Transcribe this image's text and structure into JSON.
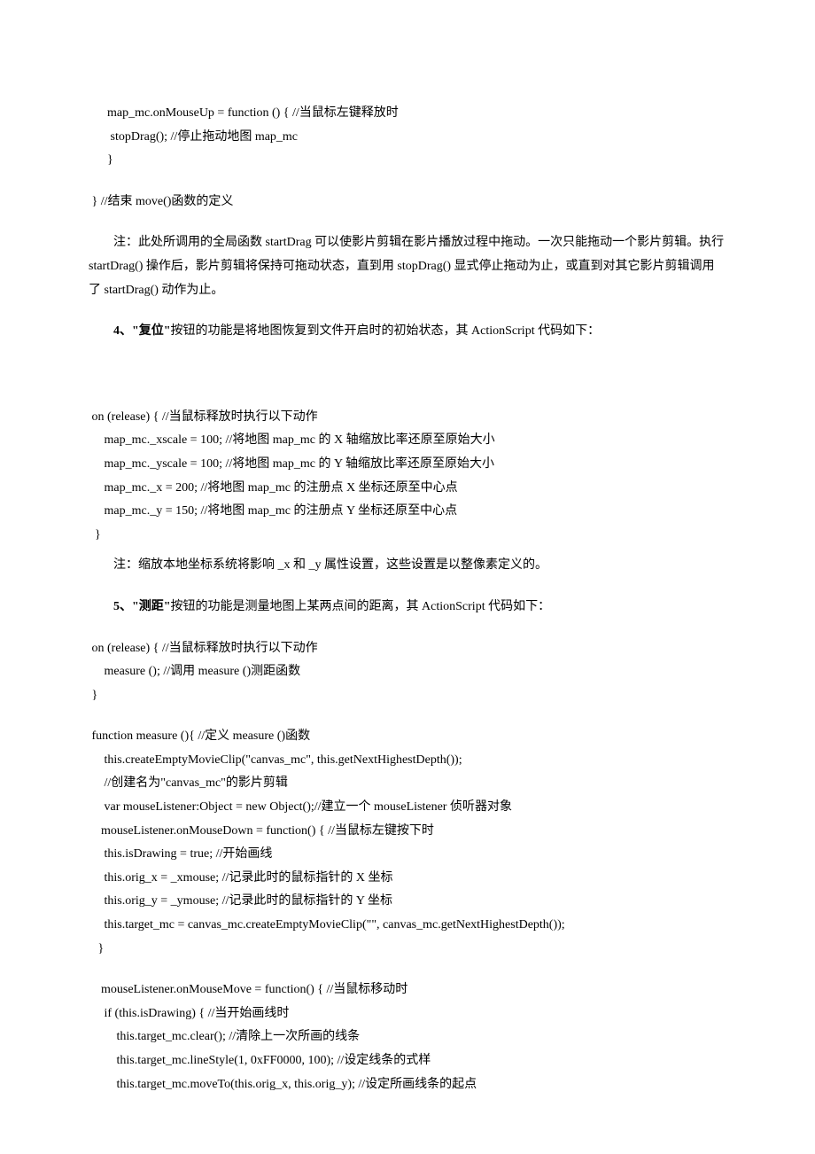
{
  "code1": {
    "l1": "      map_mc.onMouseUp = function () { //当鼠标左键释放时",
    "l2": "       stopDrag(); //停止拖动地图 map_mc",
    "l3": "      }",
    "l4": "",
    "l5": " } //结束 move()函数的定义"
  },
  "note1": "注：此处所调用的全局函数 startDrag 可以使影片剪辑在影片播放过程中拖动。一次只能拖动一个影片剪辑。执行 startDrag()  操作后，影片剪辑将保持可拖动状态，直到用  stopDrag()  显式停止拖动为止，或直到对其它影片剪辑调用了  startDrag()  动作为止。",
  "section4": {
    "prefix": "4、",
    "strong": "\"复位\"",
    "suffix": "按钮的功能是将地图恢复到文件开启时的初始状态，其 ActionScript 代码如下："
  },
  "code2": {
    "l1": " on (release) { //当鼠标释放时执行以下动作",
    "l2": "     map_mc._xscale = 100; //将地图 map_mc 的 X 轴缩放比率还原至原始大小",
    "l3": "     map_mc._yscale = 100; //将地图 map_mc 的 Y 轴缩放比率还原至原始大小",
    "l4": "     map_mc._x = 200; //将地图 map_mc 的注册点 X 坐标还原至中心点",
    "l5": "     map_mc._y = 150; //将地图 map_mc 的注册点 Y 坐标还原至中心点",
    "l6": "  }"
  },
  "note2": "注：缩放本地坐标系统将影响  _x  和  _y  属性设置，这些设置是以整像素定义的。",
  "section5": {
    "prefix": "5、",
    "strong": "\"测距\"",
    "suffix": "按钮的功能是测量地图上某两点间的距离，其 ActionScript 代码如下："
  },
  "code3": {
    "l1": " on (release) { //当鼠标释放时执行以下动作",
    "l2": "     measure (); //调用 measure ()测距函数",
    "l3": " }",
    "l4": "",
    "l5": " function measure (){ //定义 measure ()函数",
    "l6": "     this.createEmptyMovieClip(\"canvas_mc\", this.getNextHighestDepth());",
    "l7": "     //创建名为\"canvas_mc\"的影片剪辑",
    "l8": "     var mouseListener:Object = new Object();//建立一个 mouseListener 侦听器对象",
    "l9": "    mouseListener.onMouseDown = function() { //当鼠标左键按下时",
    "l10": "     this.isDrawing = true; //开始画线",
    "l11": "     this.orig_x = _xmouse; //记录此时的鼠标指针的 X 坐标",
    "l12": "     this.orig_y = _ymouse; //记录此时的鼠标指针的 Y 坐标",
    "l13": "     this.target_mc = canvas_mc.createEmptyMovieClip(\"\", canvas_mc.getNextHighestDepth());",
    "l14": "   }",
    "l15": "",
    "l16": "    mouseListener.onMouseMove = function() { //当鼠标移动时",
    "l17": "     if (this.isDrawing) { //当开始画线时",
    "l18": "         this.target_mc.clear(); //清除上一次所画的线条",
    "l19": "         this.target_mc.lineStyle(1, 0xFF0000, 100); //设定线条的式样",
    "l20": "         this.target_mc.moveTo(this.orig_x, this.orig_y); //设定所画线条的起点"
  }
}
